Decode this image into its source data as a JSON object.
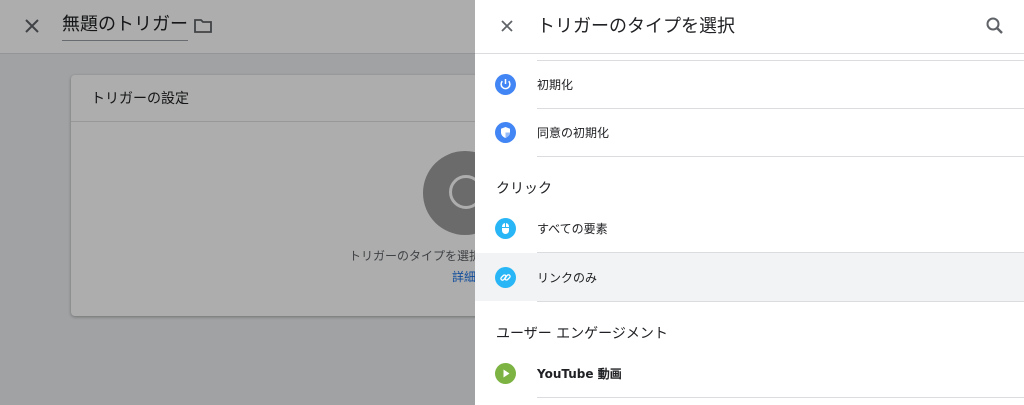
{
  "background": {
    "title": "無題のトリガー",
    "card": {
      "heading": "トリガーの設定",
      "hint": "トリガーのタイプを選択",
      "link": "詳細"
    }
  },
  "panel": {
    "title": "トリガーのタイプを選択",
    "items": [
      {
        "label": "初期化",
        "icon": "power-icon",
        "color": "#4285f4"
      },
      {
        "label": "同意の初期化",
        "icon": "shield-icon",
        "color": "#4285f4"
      }
    ],
    "sections": [
      {
        "title": "クリック",
        "items": [
          {
            "label": "すべての要素",
            "icon": "mouse-icon",
            "color": "#29b6f6"
          },
          {
            "label": "リンクのみ",
            "icon": "link-icon",
            "color": "#29b6f6"
          }
        ]
      },
      {
        "title": "ユーザー エンゲージメント",
        "items": [
          {
            "label": "YouTube 動画",
            "icon": "play-icon",
            "color": "#7cb342"
          }
        ]
      }
    ]
  },
  "colors": {
    "blue": "#4285f4",
    "light_blue": "#29b6f6",
    "green": "#7cb342",
    "hover": "#f1f3f4"
  }
}
